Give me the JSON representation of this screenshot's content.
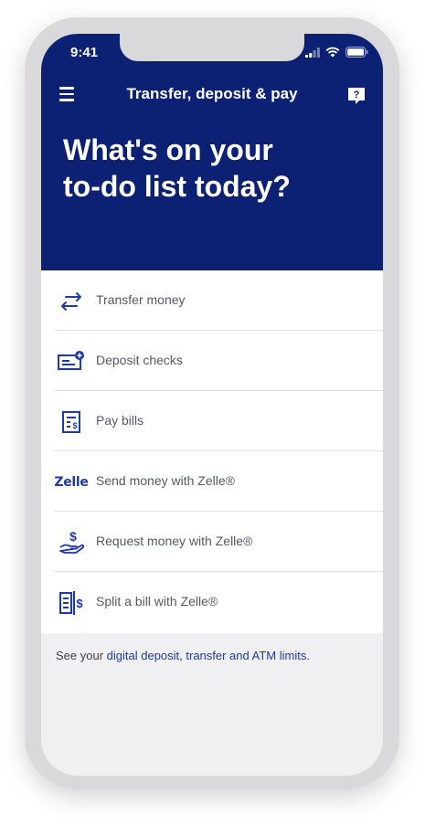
{
  "status_bar": {
    "time": "9:41"
  },
  "header": {
    "title": "Transfer, deposit & pay",
    "headline_line1": "What's on your",
    "headline_line2": "to-do list today?"
  },
  "actions": [
    {
      "label": "Transfer money",
      "icon": "transfer-arrows-icon"
    },
    {
      "label": "Deposit checks",
      "icon": "deposit-check-icon"
    },
    {
      "label": "Pay bills",
      "icon": "bill-icon"
    },
    {
      "label": "Send money with Zelle®",
      "icon": "zelle-logo",
      "logo_text": "Zelle"
    },
    {
      "label": "Request money with Zelle®",
      "icon": "hand-dollar-icon"
    },
    {
      "label": "Split a bill with Zelle®",
      "icon": "split-bill-icon"
    }
  ],
  "footer": {
    "prefix": "See your ",
    "link": "digital deposit, transfer and ATM limits",
    "suffix": "."
  },
  "colors": {
    "brand_navy": "#0c2074",
    "icon_blue": "#1e3aa8",
    "background": "#f0f0f3"
  }
}
